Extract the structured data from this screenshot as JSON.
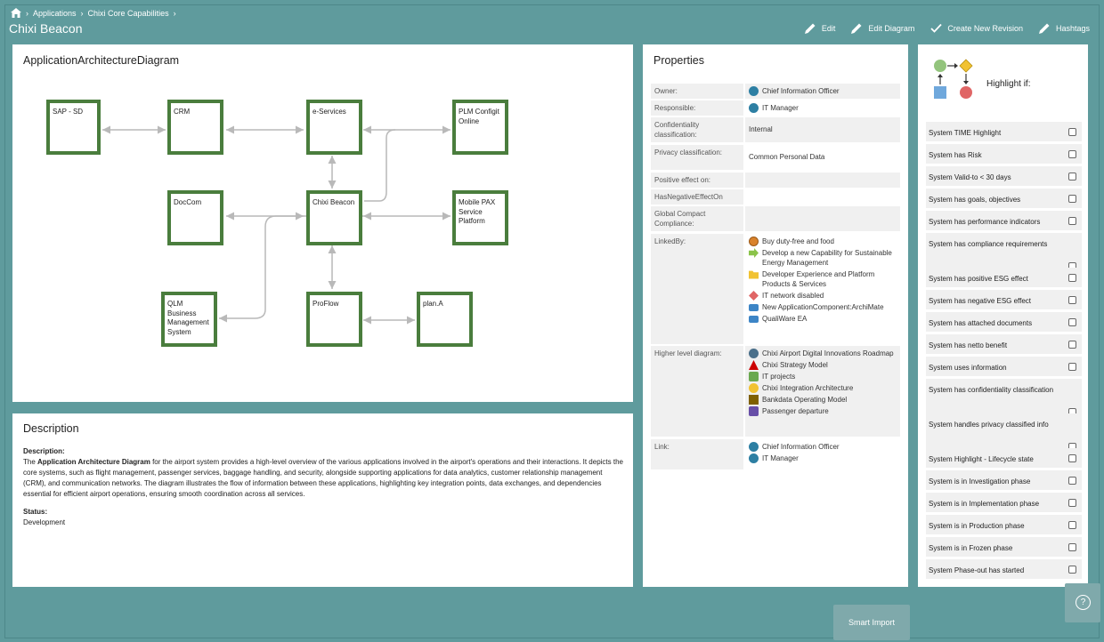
{
  "breadcrumb": {
    "items": [
      "Applications",
      "Chixi Core Capabilities"
    ],
    "sep": "›"
  },
  "app": {
    "title": "Chixi Beacon"
  },
  "toolbar": {
    "edit": "Edit",
    "edit_diagram": "Edit Diagram",
    "create_revision": "Create New Revision",
    "hashtags": "Hashtags"
  },
  "diagram": {
    "title": "ApplicationArchitectureDiagram",
    "nodes": {
      "sap": "SAP - SD",
      "crm": "CRM",
      "eservices": "e-Services",
      "plm": "PLM Configit Online",
      "doccom": "DocCom",
      "chixi": "Chixi Beacon",
      "mobile": "Mobile PAX Service Platform",
      "qlm": "QLM Business Management System",
      "proflow": "ProFlow",
      "plana": "plan.A"
    }
  },
  "description": {
    "title": "Description",
    "label": "Description:",
    "text_prefix": "The ",
    "text_bold": "Application Architecture Diagram",
    "text_rest": " for the airport system provides a high-level overview of the various applications involved in the airport's operations and their interactions. It depicts the core systems, such as flight management, passenger services, baggage handling, and security, alongside supporting applications for data analytics, customer relationship management (CRM), and communication networks. The diagram illustrates the flow of information between these applications, highlighting key integration points, data exchanges, and dependencies essential for efficient airport operations, ensuring smooth coordination across all services.",
    "status_label": "Status:",
    "status_value": "Development"
  },
  "properties": {
    "title": "Properties",
    "owner_key": "Owner:",
    "owner_val": "Chief Information Officer",
    "responsible_key": "Responsible:",
    "responsible_val": "IT Manager",
    "conf_key": "Confidentiality classification:",
    "conf_val": "Internal",
    "priv_key": "Privacy classification:",
    "priv_val": "Common Personal Data",
    "pos_key": "Positive effect on:",
    "neg_key": "HasNegativeEffectOn",
    "gcc_key": "Global Compact Compliance:",
    "linked_key": "LinkedBy:",
    "linked": [
      "Buy duty-free and food",
      "Develop a new Capability for Sustainable Energy Management",
      "Developer Experience and Platform Products & Services",
      "IT network disabled",
      "New ApplicationComponent:ArchiMate",
      "QualiWare EA"
    ],
    "higher_key": "Higher level diagram:",
    "higher": [
      "Chixi Airport Digital Innovations Roadmap",
      "Chixi Strategy Model",
      "IT projects",
      "Chixi Integration Architecture",
      "Bankdata Operating Model",
      "Passenger departure"
    ],
    "link_key": "Link:",
    "links": [
      "Chief Information Officer",
      "IT Manager"
    ]
  },
  "highlight": {
    "title": "Highlight if:",
    "items": [
      "System TIME Highlight",
      "System has Risk",
      "System Valid-to < 30 days",
      "System has goals, objectives",
      "System has performance indicators",
      "System has compliance requirements",
      "System has positive ESG effect",
      "System has negative ESG effect",
      "System has attached documents",
      "System has netto benefit",
      "System uses information",
      "System has confidentiality classification",
      "System handles privacy classified info",
      "System Highlight - Lifecycle state",
      "System is in Investigation phase",
      "System is in Implementation phase",
      "System is in Production phase",
      "System is in Frozen phase",
      "System Phase-out has started"
    ]
  },
  "footer": {
    "smart_import": "Smart Import",
    "help_glyph": "?"
  }
}
